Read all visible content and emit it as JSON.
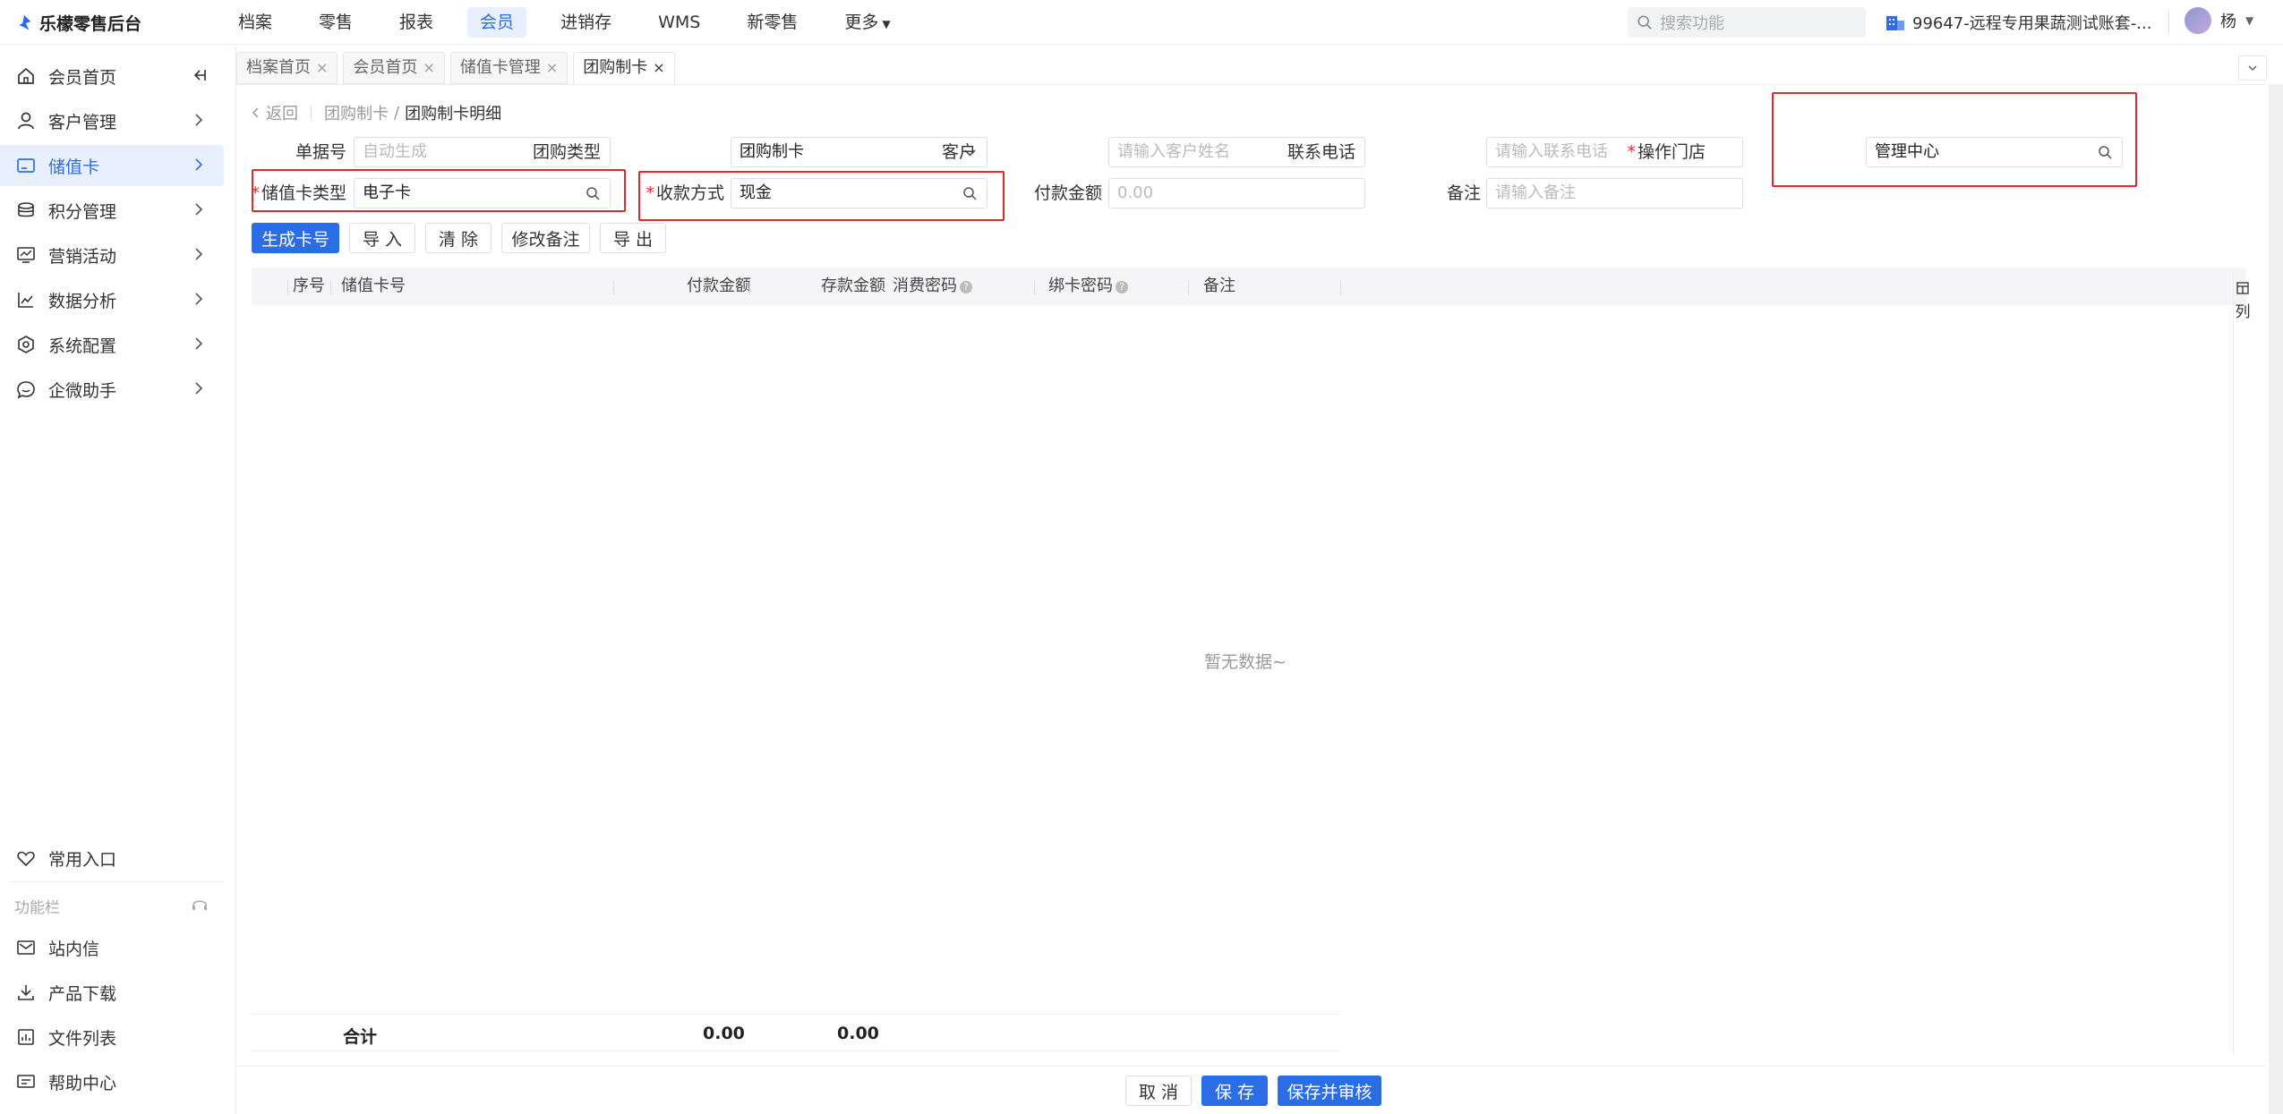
{
  "app": {
    "title": "乐檬零售后台"
  },
  "topnav": {
    "items": [
      {
        "label": "档案",
        "active": false
      },
      {
        "label": "零售",
        "active": false
      },
      {
        "label": "报表",
        "active": false
      },
      {
        "label": "会员",
        "active": true
      },
      {
        "label": "进销存",
        "active": false
      },
      {
        "label": "WMS",
        "active": false
      },
      {
        "label": "新零售",
        "active": false
      },
      {
        "label": "更多",
        "active": false
      }
    ],
    "search_placeholder": "搜索功能",
    "account_label": "99647-远程专用果蔬测试账套-...",
    "user_name": "杨"
  },
  "sidebar": {
    "items": [
      {
        "label": "会员首页",
        "icon": "home-icon"
      },
      {
        "label": "客户管理",
        "icon": "user-icon"
      },
      {
        "label": "储值卡",
        "icon": "card-icon",
        "active": true
      },
      {
        "label": "积分管理",
        "icon": "coins-icon"
      },
      {
        "label": "营销活动",
        "icon": "monitor-icon"
      },
      {
        "label": "数据分析",
        "icon": "chart-icon"
      },
      {
        "label": "系统配置",
        "icon": "settings-icon"
      },
      {
        "label": "企微助手",
        "icon": "chat-icon"
      }
    ],
    "favorites_label": "常用入口",
    "toolbar_label": "功能栏",
    "tools": [
      {
        "label": "站内信",
        "icon": "mail-icon"
      },
      {
        "label": "产品下载",
        "icon": "download-icon"
      },
      {
        "label": "文件列表",
        "icon": "file-list-icon"
      },
      {
        "label": "帮助中心",
        "icon": "help-icon"
      }
    ]
  },
  "tabs": [
    {
      "label": "档案首页",
      "close": "×"
    },
    {
      "label": "会员首页",
      "close": "×"
    },
    {
      "label": "储值卡管理",
      "close": "×"
    },
    {
      "label": "团购制卡",
      "close": "×",
      "active": true
    }
  ],
  "breadcrumb": {
    "back": "返回",
    "parent": "团购制卡",
    "separator": "/",
    "current": "团购制卡明细"
  },
  "form": {
    "doc_no": {
      "label": "单据号",
      "placeholder": "自动生成"
    },
    "group_type": {
      "label": "团购类型",
      "value": "团购制卡"
    },
    "customer": {
      "label": "客户",
      "placeholder": "请输入客户姓名"
    },
    "phone": {
      "label": "联系电话",
      "placeholder": "请输入联系电话"
    },
    "store": {
      "label": "操作门店",
      "value": "管理中心",
      "required": "*"
    },
    "card_type": {
      "label": "储值卡类型",
      "value": "电子卡",
      "required": "*"
    },
    "payment_method": {
      "label": "收款方式",
      "value": "现金",
      "required": "*"
    },
    "pay_amount": {
      "label": "付款金额",
      "placeholder": "0.00"
    },
    "remark": {
      "label": "备注",
      "placeholder": "请输入备注"
    }
  },
  "actions": {
    "generate": "生成卡号",
    "import": "导 入",
    "clear": "清 除",
    "edit_remark": "修改备注",
    "export": "导 出"
  },
  "table": {
    "columns": [
      "序号",
      "储值卡号",
      "付款金额",
      "存款金额",
      "消费密码",
      "绑卡密码",
      "备注"
    ],
    "help_glyph": "?",
    "column_toggle": "列",
    "empty_text": "暂无数据~",
    "total_label": "合计",
    "total_pay": "0.00",
    "total_deposit": "0.00"
  },
  "footer": {
    "cancel": "取 消",
    "save": "保 存",
    "save_audit": "保存并审核"
  },
  "colors": {
    "primary": "#2b6de5",
    "highlight_box": "#e12a2a",
    "required": "#f5222d"
  }
}
